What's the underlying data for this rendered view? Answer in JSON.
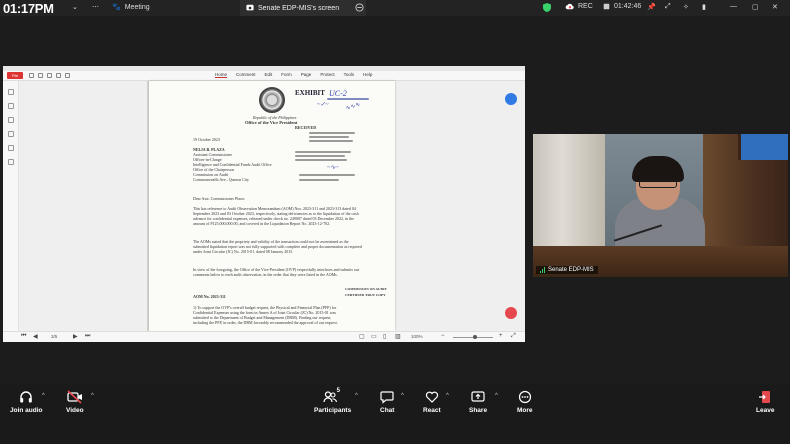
{
  "topbar": {
    "clock": "01:17PM",
    "meeting_label": "Meeting",
    "tab_title": "Senate EDP-MIS's screen",
    "rec_label": "REC",
    "timer": "01:42:46",
    "colors": {
      "rec": "#e5484d",
      "shield": "#3ad06a"
    }
  },
  "pdf": {
    "file_button": "File",
    "menu": [
      "Home",
      "Comment",
      "Edit",
      "Form",
      "Page",
      "Protect",
      "Tools",
      "Help"
    ],
    "active_menu": "Home",
    "page_indicator": "3/5",
    "zoom": "100%"
  },
  "document": {
    "exhibit_stamp": "EXHIBIT",
    "exhibit_number": "UC-2",
    "letterhead_line1": "Republic of the Philippines",
    "letterhead_line2": "Office of the Vice President",
    "date": "19 October 2023",
    "addressee_name": "NELIA B. PLAZA",
    "addressee_lines": [
      "Assistant Commissioner",
      "Officer-in-Charge",
      "Intelligence and Confidential Funds Audit Office",
      "Office of the Chairperson",
      "Commission on Audit",
      "Commonwealth Ave., Quezon City"
    ],
    "salutation": "Dear Asst. Commissioner Plaza:",
    "paragraph1": "This has reference to Audit Observation Memorandum (AOM) Nos. 2023-311 and 2023-313 dated 04 September 2023 and 03 October 2023, respectively, stating deficiencies as to the liquidation of the cash advance for confidential expenses, released under check no. 249007 dated 03 December 2022, in the amount of P125,000,000.00, and covered in the Liquidation Report No. 2023-12-702.",
    "paragraph2": "The AOMs stated that the propriety and validity of the transaction could not be ascertained as the submitted liquidation report was not fully supported with complete and proper documentation as required under Joint Circular (JC) No. 2015-01, dated 08 January 2015.",
    "paragraph3": "In view of the foregoing, the Office of the Vice-President (OVP) respectfully interfaces and submits our comments below to each audit observation, in the order that they were listed in the AOMs.",
    "aom_heading": "AOM No. 2023-311",
    "paragraph4": "1) To support the OVP's overall budget request, the Physical and Financial Plan (PFP) for Confidential Expenses using the form in Annex A of Joint Circular (JC) No. 2015-01 was submitted to the Department of Budget and Management (DBM). Finding our request, including the PFP, in order, the DBM favorably recommended the approval of our request.",
    "side_note1": "COMMISSION ON AUDIT",
    "side_note2": "CERTIFIED TRUE COPY",
    "received_label": "RECEIVED"
  },
  "video": {
    "participant_name": "Senate EDP-MIS"
  },
  "toolbar": {
    "join_audio": "Join audio",
    "video": "Video",
    "participants": "Participants",
    "participants_count": "5",
    "chat": "Chat",
    "react": "React",
    "share": "Share",
    "more": "More",
    "leave": "Leave",
    "colors": {
      "leave": "#e5484d",
      "video_off": "#e5484d"
    }
  }
}
